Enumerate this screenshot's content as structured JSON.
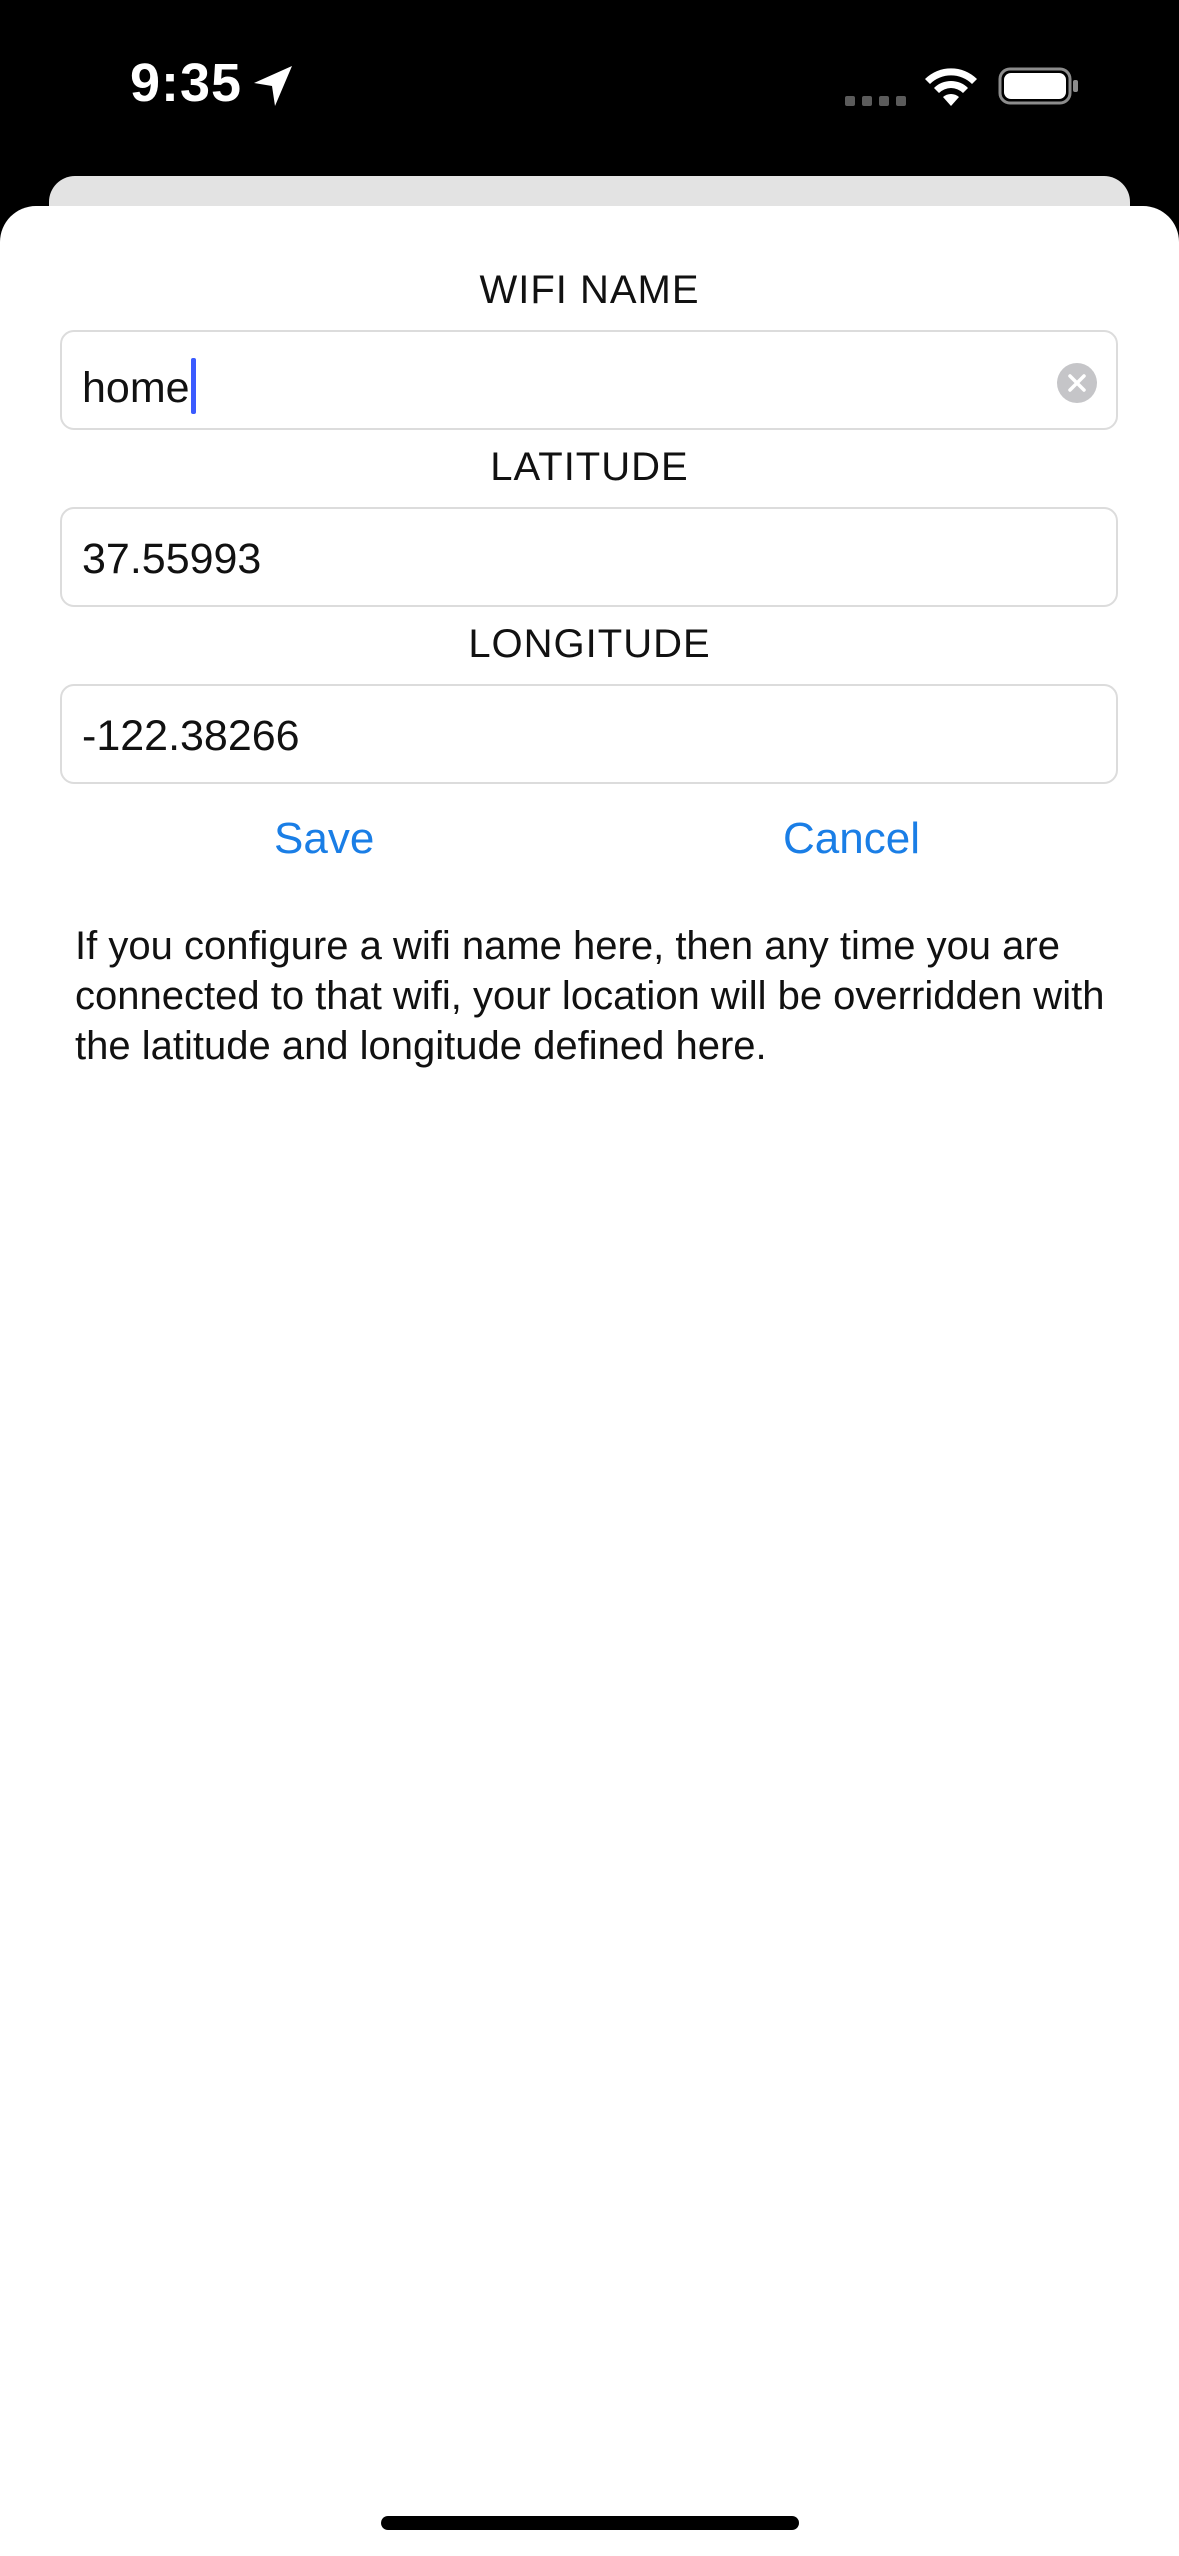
{
  "status_bar": {
    "time": "9:35",
    "location_icon": "location-arrow-icon",
    "signal_icon": "signal-dots-icon",
    "wifi_icon": "wifi-icon",
    "battery_icon": "battery-icon"
  },
  "form": {
    "wifi_name": {
      "label": "WIFI NAME",
      "value": "home",
      "clear_icon": "clear-icon"
    },
    "latitude": {
      "label": "LATITUDE",
      "value": "37.55993"
    },
    "longitude": {
      "label": "LONGITUDE",
      "value": "-122.38266"
    },
    "save_label": "Save",
    "cancel_label": "Cancel"
  },
  "info_text": "If you configure a wifi name here, then any time you are connected to that wifi, your location will be overridden with the latitude and longitude defined here.",
  "colors": {
    "accent": "#1a7ee6",
    "cursor": "#3b5bff"
  }
}
